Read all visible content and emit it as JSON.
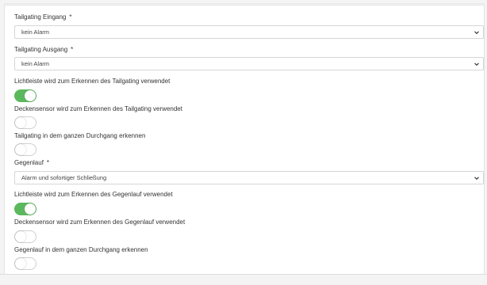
{
  "form": {
    "required_mark": "*",
    "tailgating_entry": {
      "label": "Tailgating Eingang",
      "value": "kein Alarm"
    },
    "tailgating_exit": {
      "label": "Tailgating Ausgang",
      "value": "kein Alarm"
    },
    "tailgating_lightbar": {
      "label": "Lichtleiste wird zum Erkennen des Tailgating verwendet",
      "enabled": true
    },
    "tailgating_ceiling": {
      "label": "Deckensensor wird zum Erkennen des Tailgating verwendet",
      "enabled": false
    },
    "tailgating_whole_passage": {
      "label": "Tailgating in dem ganzen Durchgang erkennen",
      "enabled": false
    },
    "counterflow": {
      "label": "Gegenlauf",
      "value": "Alarm und sofortiger Schließung"
    },
    "counterflow_lightbar": {
      "label": "Lichtleiste wird zum Erkennen des Gegenlauf verwendet",
      "enabled": true
    },
    "counterflow_ceiling": {
      "label": "Deckensensor wird zum Erkennen des Gegenlauf verwendet",
      "enabled": false
    },
    "counterflow_whole_passage": {
      "label": "Gegenlauf in dem ganzen Durchgang erkennen",
      "enabled": false
    }
  },
  "colors": {
    "toggle_on": "#5cb85c",
    "toggle_off_border": "#cfcfcf",
    "select_border": "#d6d6d6"
  },
  "icons": {
    "select_arrow": "chevron-down-icon"
  }
}
